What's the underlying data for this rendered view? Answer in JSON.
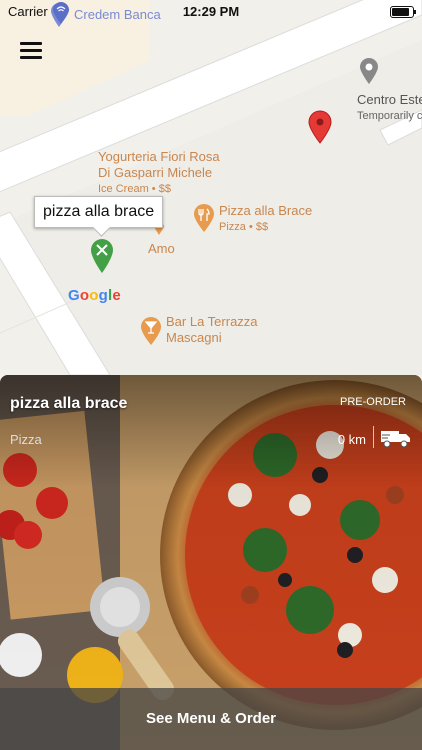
{
  "status_bar": {
    "carrier": "Carrier",
    "time": "12:29 PM",
    "battery_level": 0.9,
    "wifi_icon": "wifi-icon",
    "battery_icon": "battery-icon"
  },
  "map": {
    "menu_icon": "hamburger-menu-icon",
    "selected_label": "pizza alla brace",
    "google_logo": "Google",
    "google_colors": [
      "#4285F4",
      "#EA4335",
      "#FBBC05",
      "#4285F4",
      "#34A853",
      "#EA4335"
    ],
    "pois": {
      "credem": {
        "name": "Credem Banca"
      },
      "centro": {
        "name": "Centro Este",
        "status": "Temporarily cl"
      },
      "yogurteria": {
        "name_line1": "Yogurteria Fiori Rosa",
        "name_line2": "Di Gasparri Michele",
        "sub": "Ice Cream • $$"
      },
      "pizza_brace": {
        "name": "Pizza alla Brace",
        "sub": "Pizza • $$"
      },
      "amo": {
        "name": "Amo"
      },
      "bar_terrazza": {
        "name_line1": "Bar La Terrazza",
        "name_line2": "Mascagni"
      }
    }
  },
  "restaurant_card": {
    "name": "pizza alla brace",
    "badge": "PRE-ORDER",
    "category": "Pizza",
    "distance": "0 km",
    "delivery_icon": "delivery-truck-icon",
    "cta": "See Menu & Order"
  },
  "colors": {
    "poi_orange": "#c9864f",
    "marker_red": "#e53935",
    "marker_green": "#43a047",
    "poi_blue": "#7a8bd4"
  }
}
